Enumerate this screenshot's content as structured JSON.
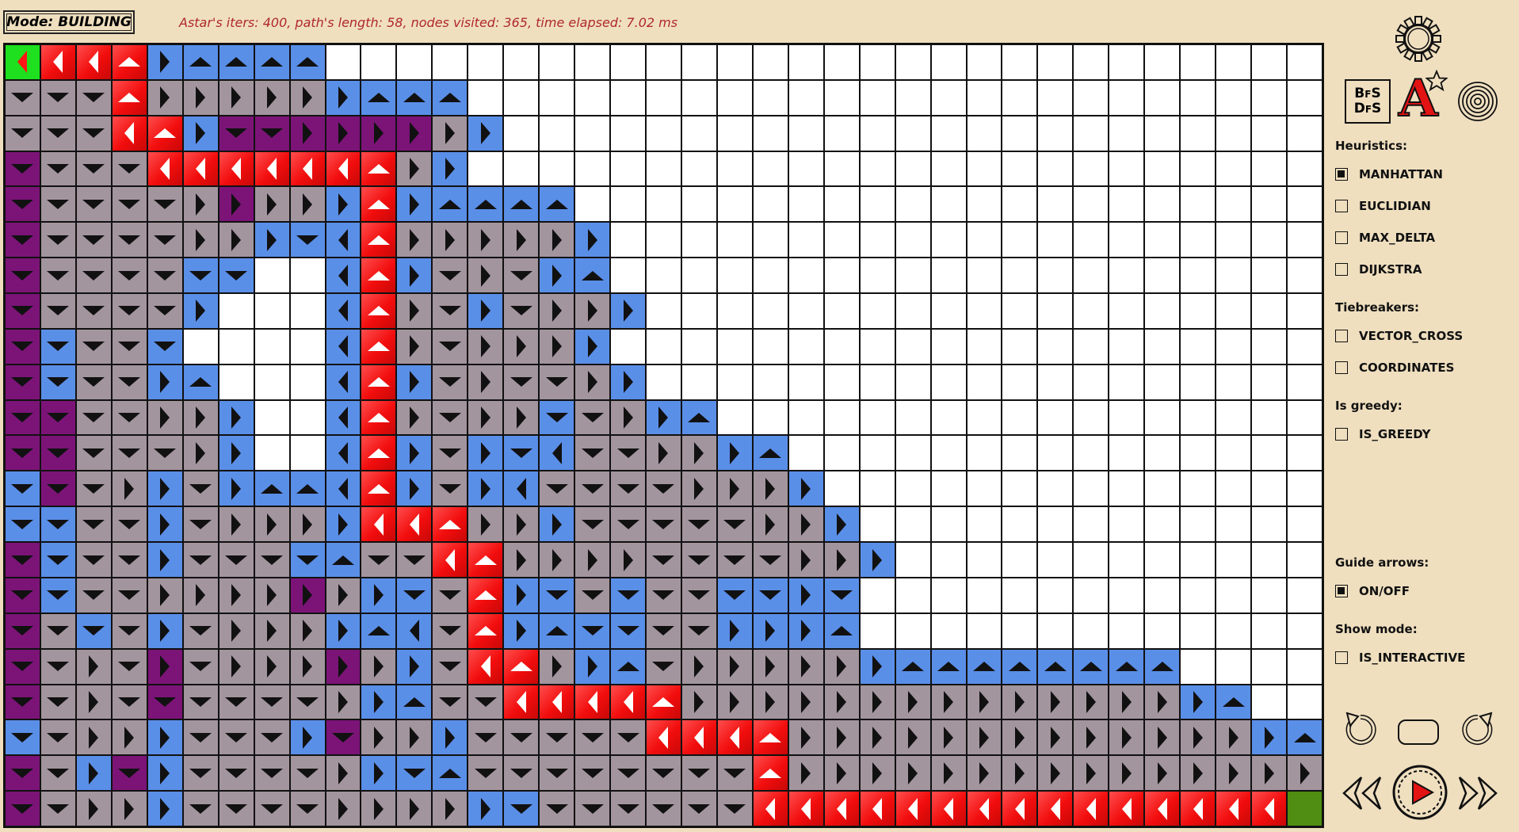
{
  "mode": "Mode: BUILDING",
  "stats": "Astar's iters: 400, path's length: 58, nodes visited: 365, time elapsed: 7.02 ms",
  "colors": {
    "background": "#efdfbf",
    "empty": "#ffffff",
    "visited": "#a3959e",
    "frontier": "#5a8fe8",
    "dark": "#7c1478",
    "path": "#f20d0d",
    "start": "#1ee01e",
    "end": "#4f8e12",
    "stats_text": "#b0282a"
  },
  "toolbar": {
    "settings_icon": "gear-icon",
    "algo_buttons": [
      "bfs-dfs-icon",
      "astar-icon",
      "wave-icon"
    ],
    "bfs_dfs_glyph": [
      "B",
      "F",
      "S",
      "D",
      "F",
      "S"
    ],
    "astar_glyph": "A"
  },
  "heuristics": {
    "label": "Heuristics:",
    "options": [
      {
        "label": "MANHATTAN",
        "checked": true
      },
      {
        "label": "EUCLIDIAN",
        "checked": false
      },
      {
        "label": "MAX_DELTA",
        "checked": false
      },
      {
        "label": "DIJKSTRA",
        "checked": false
      }
    ]
  },
  "tiebreakers": {
    "label": "Tiebreakers:",
    "options": [
      {
        "label": "VECTOR_CROSS",
        "checked": false
      },
      {
        "label": "COORDINATES",
        "checked": false
      }
    ]
  },
  "greedy": {
    "label": "Is greedy:",
    "options": [
      {
        "label": "IS_GREEDY",
        "checked": false
      }
    ]
  },
  "guide_arrows": {
    "label": "Guide arrows:",
    "options": [
      {
        "label": "ON/OFF",
        "checked": true
      }
    ]
  },
  "show_mode": {
    "label": "Show mode:",
    "options": [
      {
        "label": "IS_INTERACTIVE",
        "checked": false
      }
    ]
  },
  "playback": [
    "undo-icon",
    "stop-icon",
    "redo-icon",
    "rewind-icon",
    "play-icon",
    "fast-forward-icon"
  ],
  "grid": {
    "cols": 37,
    "rows": 22,
    "legend": "cell tokens: color letter + arrow letter (W empty, G visited, B frontier, P dark, R path, S start, E end; u/d/l/r arrow direction)",
    "cells": [
      [
        "Sl",
        "Rl",
        "Rl",
        "Ru",
        "Br",
        "Bu",
        "Bu",
        "Bu",
        "Bu",
        "W",
        "W",
        "W",
        "W",
        "W",
        "W",
        "W",
        "W",
        "W",
        "W",
        "W",
        "W",
        "W",
        "W",
        "W",
        "W",
        "W",
        "W",
        "W",
        "W",
        "W",
        "W",
        "W",
        "W",
        "W",
        "W",
        "W",
        "W"
      ],
      [
        "Gd",
        "Gd",
        "Gd",
        "Ru",
        "Gr",
        "Gr",
        "Gr",
        "Gr",
        "Gr",
        "Br",
        "Bu",
        "Bu",
        "Bu",
        "W",
        "W",
        "W",
        "W",
        "W",
        "W",
        "W",
        "W",
        "W",
        "W",
        "W",
        "W",
        "W",
        "W",
        "W",
        "W",
        "W",
        "W",
        "W",
        "W",
        "W",
        "W",
        "W",
        "W"
      ],
      [
        "Gd",
        "Gd",
        "Gd",
        "Rl",
        "Ru",
        "Br",
        "Pd",
        "Pd",
        "Pr",
        "Pr",
        "Pr",
        "Pr",
        "Gr",
        "Br",
        "W",
        "W",
        "W",
        "W",
        "W",
        "W",
        "W",
        "W",
        "W",
        "W",
        "W",
        "W",
        "W",
        "W",
        "W",
        "W",
        "W",
        "W",
        "W",
        "W",
        "W",
        "W",
        "W"
      ],
      [
        "Pd",
        "Gd",
        "Gd",
        "Gd",
        "Rl",
        "Rl",
        "Rl",
        "Rl",
        "Rl",
        "Rl",
        "Ru",
        "Gr",
        "Br",
        "W",
        "W",
        "W",
        "W",
        "W",
        "W",
        "W",
        "W",
        "W",
        "W",
        "W",
        "W",
        "W",
        "W",
        "W",
        "W",
        "W",
        "W",
        "W",
        "W",
        "W",
        "W",
        "W",
        "W"
      ],
      [
        "Pd",
        "Gd",
        "Gd",
        "Gd",
        "Gd",
        "Gr",
        "Pr",
        "Gr",
        "Gr",
        "Br",
        "Ru",
        "Br",
        "Bu",
        "Bu",
        "Bu",
        "Bu",
        "W",
        "W",
        "W",
        "W",
        "W",
        "W",
        "W",
        "W",
        "W",
        "W",
        "W",
        "W",
        "W",
        "W",
        "W",
        "W",
        "W",
        "W",
        "W",
        "W",
        "W"
      ],
      [
        "Pd",
        "Gd",
        "Gd",
        "Gd",
        "Gd",
        "Gr",
        "Gr",
        "Br",
        "Bd",
        "Bl",
        "Ru",
        "Gr",
        "Gr",
        "Gr",
        "Gr",
        "Gr",
        "Br",
        "W",
        "W",
        "W",
        "W",
        "W",
        "W",
        "W",
        "W",
        "W",
        "W",
        "W",
        "W",
        "W",
        "W",
        "W",
        "W",
        "W",
        "W",
        "W",
        "W"
      ],
      [
        "Pd",
        "Gd",
        "Gd",
        "Gd",
        "Gd",
        "Bd",
        "Bd",
        "W",
        "W",
        "Bl",
        "Ru",
        "Br",
        "Gd",
        "Gr",
        "Gd",
        "Br",
        "Bu",
        "W",
        "W",
        "W",
        "W",
        "W",
        "W",
        "W",
        "W",
        "W",
        "W",
        "W",
        "W",
        "W",
        "W",
        "W",
        "W",
        "W",
        "W",
        "W",
        "W"
      ],
      [
        "Pd",
        "Gd",
        "Gd",
        "Gd",
        "Gd",
        "Br",
        "W",
        "W",
        "W",
        "Bl",
        "Ru",
        "Gr",
        "Gd",
        "Br",
        "Gd",
        "Gr",
        "Gr",
        "Br",
        "W",
        "W",
        "W",
        "W",
        "W",
        "W",
        "W",
        "W",
        "W",
        "W",
        "W",
        "W",
        "W",
        "W",
        "W",
        "W",
        "W",
        "W",
        "W"
      ],
      [
        "Pd",
        "Bd",
        "Gd",
        "Gd",
        "Bd",
        "W",
        "W",
        "W",
        "W",
        "Bl",
        "Ru",
        "Gr",
        "Gd",
        "Gr",
        "Gr",
        "Gr",
        "Br",
        "W",
        "W",
        "W",
        "W",
        "W",
        "W",
        "W",
        "W",
        "W",
        "W",
        "W",
        "W",
        "W",
        "W",
        "W",
        "W",
        "W",
        "W",
        "W",
        "W"
      ],
      [
        "Pd",
        "Bd",
        "Gd",
        "Gd",
        "Br",
        "Bu",
        "W",
        "W",
        "W",
        "Bl",
        "Ru",
        "Br",
        "Gd",
        "Gr",
        "Gd",
        "Gd",
        "Gr",
        "Br",
        "W",
        "W",
        "W",
        "W",
        "W",
        "W",
        "W",
        "W",
        "W",
        "W",
        "W",
        "W",
        "W",
        "W",
        "W",
        "W",
        "W",
        "W",
        "W"
      ],
      [
        "Pd",
        "Pd",
        "Gd",
        "Gd",
        "Gr",
        "Gr",
        "Br",
        "W",
        "W",
        "Bl",
        "Ru",
        "Gr",
        "Gd",
        "Gr",
        "Gr",
        "Bd",
        "Gd",
        "Gr",
        "Br",
        "Bu",
        "W",
        "W",
        "W",
        "W",
        "W",
        "W",
        "W",
        "W",
        "W",
        "W",
        "W",
        "W",
        "W",
        "W",
        "W",
        "W",
        "W"
      ],
      [
        "Pd",
        "Pd",
        "Gd",
        "Gd",
        "Gd",
        "Gr",
        "Br",
        "W",
        "W",
        "Bl",
        "Ru",
        "Br",
        "Gd",
        "Br",
        "Bd",
        "Bl",
        "Gd",
        "Gd",
        "Gr",
        "Gr",
        "Br",
        "Bu",
        "W",
        "W",
        "W",
        "W",
        "W",
        "W",
        "W",
        "W",
        "W",
        "W",
        "W",
        "W",
        "W",
        "W",
        "W"
      ],
      [
        "Bd",
        "Pd",
        "Gd",
        "Gr",
        "Br",
        "Gd",
        "Br",
        "Bu",
        "Bu",
        "Bl",
        "Ru",
        "Br",
        "Gd",
        "Br",
        "Bl",
        "Gd",
        "Gd",
        "Gd",
        "Gd",
        "Gr",
        "Gr",
        "Gr",
        "Br",
        "W",
        "W",
        "W",
        "W",
        "W",
        "W",
        "W",
        "W",
        "W",
        "W",
        "W",
        "W",
        "W",
        "W"
      ],
      [
        "Bd",
        "Bd",
        "Gd",
        "Gd",
        "Br",
        "Gd",
        "Gr",
        "Gr",
        "Gr",
        "Br",
        "Rl",
        "Rl",
        "Ru",
        "Gr",
        "Gr",
        "Br",
        "Gd",
        "Gd",
        "Gd",
        "Gd",
        "Gd",
        "Gr",
        "Gr",
        "Br",
        "W",
        "W",
        "W",
        "W",
        "W",
        "W",
        "W",
        "W",
        "W",
        "W",
        "W",
        "W",
        "W"
      ],
      [
        "Pd",
        "Bd",
        "Gd",
        "Gd",
        "Br",
        "Gd",
        "Gd",
        "Gd",
        "Bd",
        "Bu",
        "Gd",
        "Gd",
        "Rl",
        "Ru",
        "Gr",
        "Gr",
        "Gr",
        "Gr",
        "Gd",
        "Gd",
        "Gd",
        "Gd",
        "Gr",
        "Gr",
        "Br",
        "W",
        "W",
        "W",
        "W",
        "W",
        "W",
        "W",
        "W",
        "W",
        "W",
        "W",
        "W"
      ],
      [
        "Pd",
        "Bd",
        "Gd",
        "Gd",
        "Gr",
        "Gr",
        "Gr",
        "Gr",
        "Pr",
        "Gr",
        "Br",
        "Bd",
        "Gd",
        "Ru",
        "Br",
        "Bd",
        "Gd",
        "Bd",
        "Gd",
        "Gd",
        "Bd",
        "Bd",
        "Br",
        "Bd",
        "W",
        "W",
        "W",
        "W",
        "W",
        "W",
        "W",
        "W",
        "W",
        "W",
        "W",
        "W",
        "W"
      ],
      [
        "Pd",
        "Gd",
        "Bd",
        "Gd",
        "Br",
        "Gd",
        "Gr",
        "Gr",
        "Gr",
        "Br",
        "Bu",
        "Bl",
        "Gd",
        "Ru",
        "Br",
        "Bu",
        "Bd",
        "Bd",
        "Gd",
        "Gd",
        "Br",
        "Br",
        "Br",
        "Bu",
        "W",
        "W",
        "W",
        "W",
        "W",
        "W",
        "W",
        "W",
        "W",
        "W",
        "W",
        "W",
        "W"
      ],
      [
        "Pd",
        "Gd",
        "Gr",
        "Gd",
        "Pr",
        "Gd",
        "Gr",
        "Gr",
        "Gr",
        "Pr",
        "Gr",
        "Br",
        "Gd",
        "Rl",
        "Ru",
        "Gr",
        "Br",
        "Bu",
        "Gd",
        "Gr",
        "Gr",
        "Gr",
        "Gr",
        "Gr",
        "Br",
        "Bu",
        "Bu",
        "Bu",
        "Bu",
        "Bu",
        "Bu",
        "Bu",
        "Bu",
        "W",
        "W",
        "W",
        "W"
      ],
      [
        "Pd",
        "Gd",
        "Gr",
        "Gd",
        "Pd",
        "Gd",
        "Gd",
        "Gd",
        "Gd",
        "Gr",
        "Br",
        "Bu",
        "Gd",
        "Gd",
        "Rl",
        "Rl",
        "Rl",
        "Rl",
        "Ru",
        "Gr",
        "Gr",
        "Gr",
        "Gr",
        "Gr",
        "Gr",
        "Gr",
        "Gr",
        "Gr",
        "Gr",
        "Gr",
        "Gr",
        "Gr",
        "Gr",
        "Br",
        "Bu",
        "W",
        "W"
      ],
      [
        "Bd",
        "Gd",
        "Gr",
        "Gr",
        "Br",
        "Gd",
        "Gd",
        "Gd",
        "Br",
        "Pd",
        "Gr",
        "Gr",
        "Br",
        "Gd",
        "Gd",
        "Gd",
        "Gd",
        "Gd",
        "Rl",
        "Rl",
        "Rl",
        "Ru",
        "Gr",
        "Gr",
        "Gr",
        "Gr",
        "Gr",
        "Gr",
        "Gr",
        "Gr",
        "Gr",
        "Gr",
        "Gr",
        "Gr",
        "Gr",
        "Br",
        "Bu"
      ],
      [
        "Pd",
        "Gd",
        "Br",
        "Pd",
        "Br",
        "Gd",
        "Gd",
        "Gd",
        "Gd",
        "Gr",
        "Br",
        "Bd",
        "Bu",
        "Gd",
        "Gd",
        "Gd",
        "Gd",
        "Gd",
        "Gd",
        "Gd",
        "Gd",
        "Ru",
        "Gr",
        "Gr",
        "Gr",
        "Gr",
        "Gr",
        "Gr",
        "Gr",
        "Gr",
        "Gr",
        "Gr",
        "Gr",
        "Gr",
        "Gr",
        "Gr",
        "Gr"
      ],
      [
        "Pd",
        "Gd",
        "Gr",
        "Gr",
        "Br",
        "Gd",
        "Gd",
        "Gd",
        "Gd",
        "Gr",
        "Gr",
        "Gr",
        "Gr",
        "Br",
        "Bd",
        "Gd",
        "Gd",
        "Gd",
        "Gd",
        "Gd",
        "Gd",
        "Rl",
        "Rl",
        "Rl",
        "Rl",
        "Rl",
        "Rl",
        "Rl",
        "Rl",
        "Rl",
        "Rl",
        "Rl",
        "Rl",
        "Rl",
        "Rl",
        "Rl",
        "E"
      ]
    ]
  }
}
